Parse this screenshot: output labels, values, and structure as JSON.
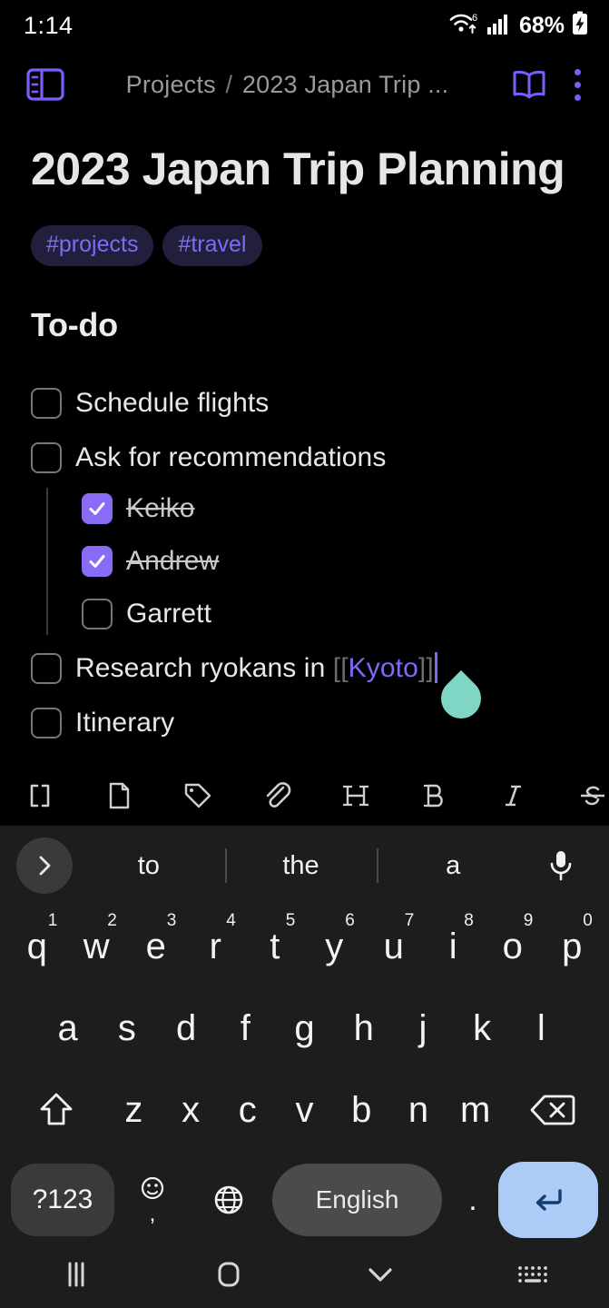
{
  "status_bar": {
    "time": "1:14",
    "wifi_icon": "wifi-6-icon",
    "signal_icon": "cellular-signal-icon",
    "battery_percent": "68%",
    "battery_icon": "battery-charging-icon"
  },
  "app_bar": {
    "sidebar_icon": "sidebar-toggle-icon",
    "breadcrumb_parent": "Projects",
    "breadcrumb_sep": "/",
    "breadcrumb_current": "2023 Japan Trip ...",
    "reading_icon": "open-book-icon",
    "menu_icon": "more-vertical-icon"
  },
  "note": {
    "title": "2023 Japan Trip Planning",
    "tags": [
      "#projects",
      "#travel"
    ],
    "section_heading": "To-do",
    "todos": [
      {
        "label": "Schedule flights",
        "checked": false,
        "level": 0,
        "strike": false
      },
      {
        "label": "Ask for recommendations",
        "checked": false,
        "level": 0,
        "strike": false
      },
      {
        "label": "Keiko",
        "checked": true,
        "level": 1,
        "strike": true
      },
      {
        "label": "Andrew",
        "checked": true,
        "level": 1,
        "strike": true
      },
      {
        "label": "Garrett",
        "checked": false,
        "level": 1,
        "strike": false
      },
      {
        "label": "Research ryokans in [[Kyoto]]",
        "checked": false,
        "level": 0,
        "strike": false,
        "link_prefix": "Research ryokans in ",
        "link_open": "[[",
        "link_text": "Kyoto",
        "link_close": "]]",
        "has_caret": true,
        "has_drag_handle": true
      },
      {
        "label": "Itinerary",
        "checked": false,
        "level": 0,
        "strike": false
      }
    ]
  },
  "editor_toolbar": {
    "items": [
      {
        "name": "wikilink-brackets-icon",
        "label": "[]"
      },
      {
        "name": "new-page-icon",
        "label": ""
      },
      {
        "name": "tag-icon",
        "label": ""
      },
      {
        "name": "attachment-paperclip-icon",
        "label": ""
      },
      {
        "name": "heading-icon",
        "label": "H"
      },
      {
        "name": "bold-icon",
        "label": "B"
      },
      {
        "name": "italic-icon",
        "label": "I"
      },
      {
        "name": "strikethrough-icon",
        "label": "S"
      }
    ]
  },
  "keyboard": {
    "expand_icon": "chevron-right-icon",
    "suggestions": [
      "to",
      "the",
      "a"
    ],
    "mic_icon": "microphone-icon",
    "row1": [
      {
        "k": "q",
        "n": "1"
      },
      {
        "k": "w",
        "n": "2"
      },
      {
        "k": "e",
        "n": "3"
      },
      {
        "k": "r",
        "n": "4"
      },
      {
        "k": "t",
        "n": "5"
      },
      {
        "k": "y",
        "n": "6"
      },
      {
        "k": "u",
        "n": "7"
      },
      {
        "k": "i",
        "n": "8"
      },
      {
        "k": "o",
        "n": "9"
      },
      {
        "k": "p",
        "n": "0"
      }
    ],
    "row2": [
      "a",
      "s",
      "d",
      "f",
      "g",
      "h",
      "j",
      "k",
      "l"
    ],
    "row3": {
      "shift_icon": "shift-icon",
      "keys": [
        "z",
        "x",
        "c",
        "v",
        "b",
        "n",
        "m"
      ],
      "backspace_icon": "backspace-icon"
    },
    "row4": {
      "symbols_label": "?123",
      "emoji_icon": "emoji-comma-icon",
      "emoji_sub": ",",
      "globe_icon": "language-globe-icon",
      "space_label": "English",
      "period_label": ".",
      "enter_icon": "enter-return-icon"
    }
  },
  "nav_bar": {
    "recents_icon": "recents-icon",
    "home_icon": "home-icon",
    "hide-keyboard_icon": "chevron-down-icon",
    "keyboard_switch_icon": "keyboard-switcher-icon"
  },
  "colors": {
    "accent_purple": "#7c5cfa",
    "checkbox_purple": "#8a6bf5",
    "tag_bg": "#221f3d",
    "tag_text": "#7c6cf5",
    "handle_teal": "#7fd6c4",
    "enter_blue": "#accbf7",
    "background": "#000000",
    "keyboard_bg": "#1d1d1e"
  }
}
